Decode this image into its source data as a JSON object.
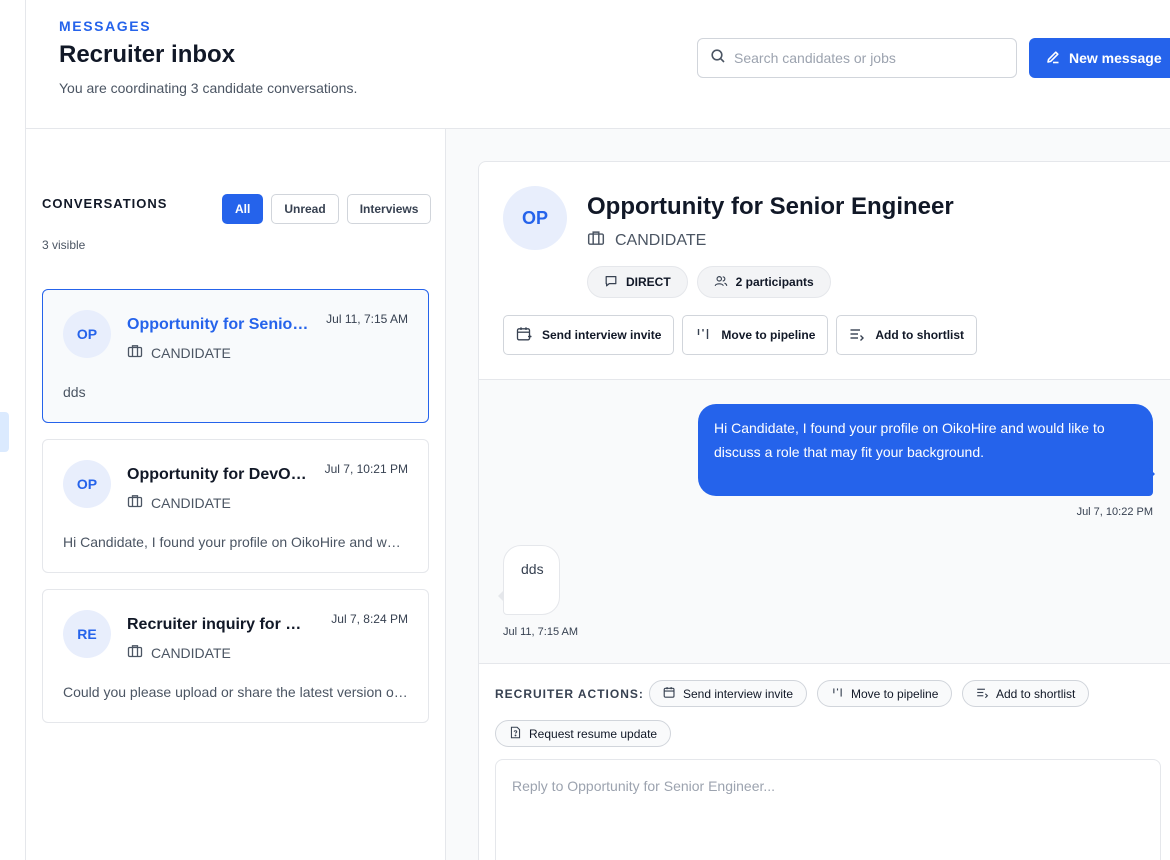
{
  "header": {
    "eyebrow": "MESSAGES",
    "title": "Recruiter inbox",
    "subtitle": "You are coordinating 3 candidate conversations.",
    "search_placeholder": "Search candidates or jobs",
    "new_message_label": "New message"
  },
  "list": {
    "heading": "CONVERSATIONS",
    "visible_count": "3 visible",
    "filters": [
      {
        "label": "All",
        "active": true
      },
      {
        "label": "Unread",
        "active": false
      },
      {
        "label": "Interviews",
        "active": false
      }
    ],
    "conversations": [
      {
        "initials": "OP",
        "title": "Opportunity for Senior Engineer",
        "time": "Jul 11, 7:15 AM",
        "role": "CANDIDATE",
        "snippet": "dds",
        "selected": true
      },
      {
        "initials": "OP",
        "title": "Opportunity for DevOps Engineer",
        "time": "Jul 7, 10:21 PM",
        "role": "CANDIDATE",
        "snippet": "Hi Candidate, I found your profile on OikoHire and would like to discuss a role",
        "selected": false
      },
      {
        "initials": "RE",
        "title": "Recruiter inquiry for QA Engineer",
        "time": "Jul 7, 8:24 PM",
        "role": "CANDIDATE",
        "snippet": "Could you please upload or share the latest version of your resume",
        "selected": false
      }
    ]
  },
  "thread": {
    "initials": "OP",
    "title": "Opportunity for Senior Engineer",
    "role": "CANDIDATE",
    "pills": {
      "type": "DIRECT",
      "participants": "2 participants"
    },
    "top_actions": {
      "invite": "Send interview invite",
      "pipeline": "Move to pipeline",
      "shortlist": "Add to shortlist"
    },
    "messages": [
      {
        "direction": "outgoing",
        "text": "Hi Candidate, I found your profile on OikoHire and would like to discuss a role that may fit your background.",
        "time": "Jul 7, 10:22 PM"
      },
      {
        "direction": "incoming",
        "text": "dds",
        "time": "Jul 11, 7:15 AM"
      }
    ],
    "recruiter_actions": {
      "label": "RECRUITER ACTIONS:",
      "invite": "Send interview invite",
      "pipeline": "Move to pipeline",
      "shortlist": "Add to shortlist",
      "resume": "Request resume update"
    },
    "reply_placeholder": "Reply to Opportunity for Senior Engineer..."
  },
  "colors": {
    "accent": "#2563eb",
    "avatar_bg": "#e8eefc",
    "border": "#e5e7eb"
  }
}
